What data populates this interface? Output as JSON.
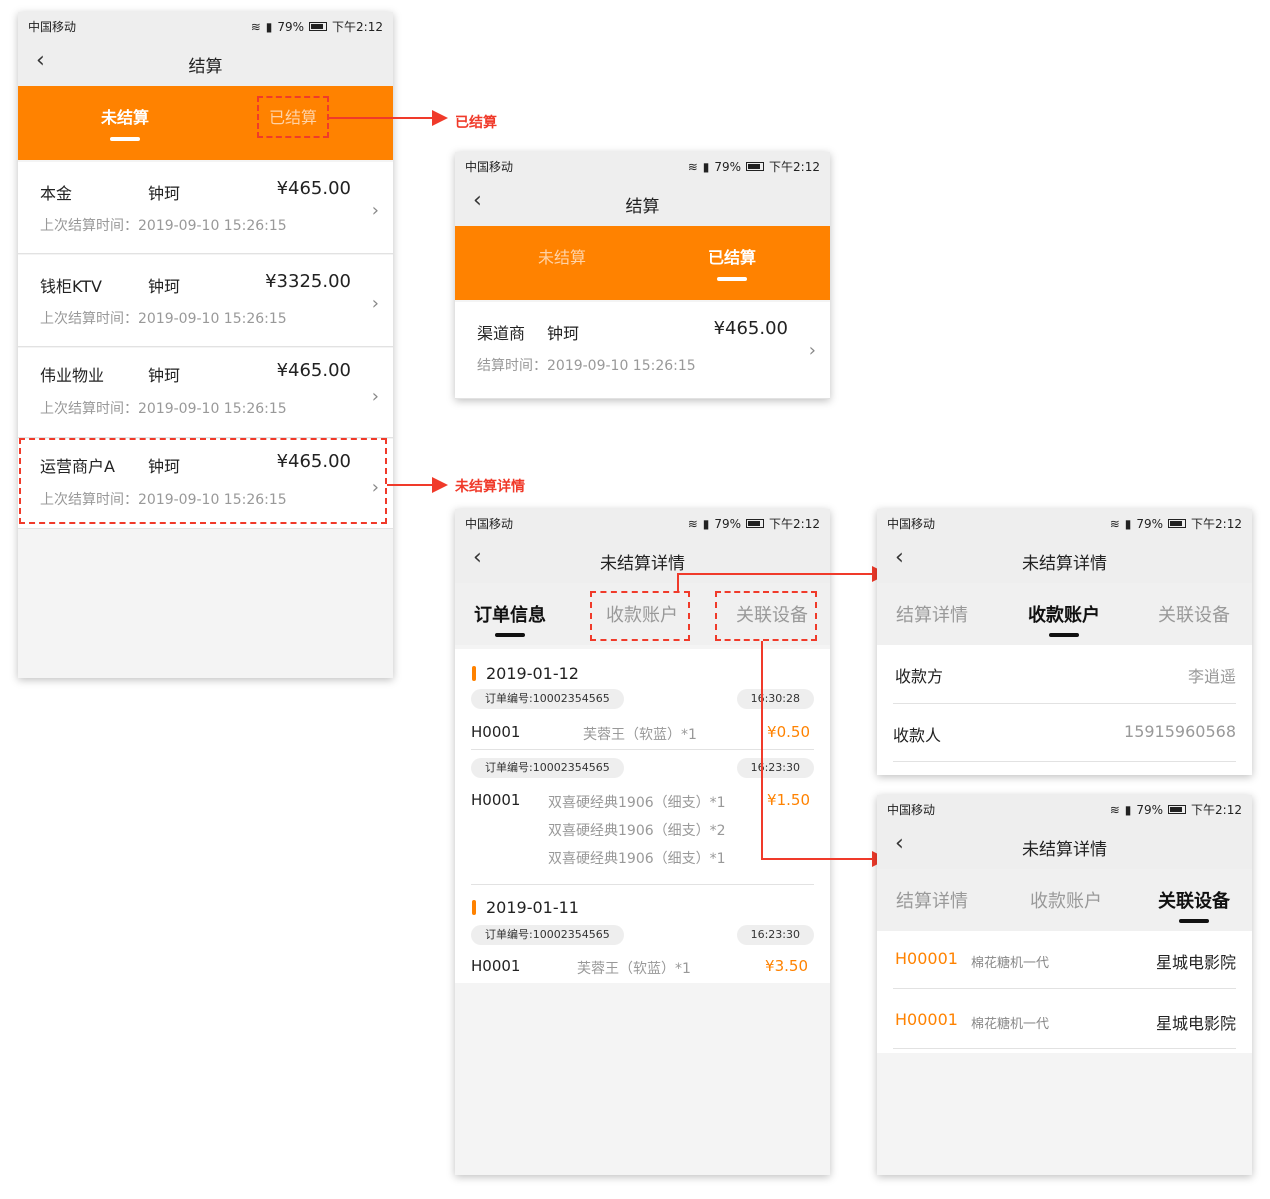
{
  "status": {
    "carrier": "中国移动",
    "battery": "79%",
    "time": "下午2:12"
  },
  "screen1": {
    "title": "结算",
    "tabs": [
      "未结算",
      "已结算"
    ],
    "rows": [
      {
        "name": "本金",
        "person": "钟珂",
        "amount": "¥465.00",
        "time": "上次结算时间：2019-09-10 15:26:15"
      },
      {
        "name": "钱柜KTV",
        "person": "钟珂",
        "amount": "¥3325.00",
        "time": "上次结算时间：2019-09-10 15:26:15"
      },
      {
        "name": "伟业物业",
        "person": "钟珂",
        "amount": "¥465.00",
        "time": "上次结算时间：2019-09-10 15:26:15"
      },
      {
        "name": "运营商户A",
        "person": "钟珂",
        "amount": "¥465.00",
        "time": "上次结算时间：2019-09-10 15:26:15"
      }
    ]
  },
  "annotations": {
    "settled": "已结算",
    "unsettled_detail": "未结算详情"
  },
  "screen2": {
    "title": "结算",
    "tabs": [
      "未结算",
      "已结算"
    ],
    "row": {
      "name": "渠道商",
      "person": "钟珂",
      "amount": "¥465.00",
      "time": "结算时间：2019-09-10 15:26:15"
    }
  },
  "screen3": {
    "title": "未结算详情",
    "tabs": [
      "订单信息",
      "收款账户",
      "关联设备"
    ],
    "groups": [
      {
        "date": "2019-01-12",
        "orders": [
          {
            "no": "订单编号:10002354565",
            "time": "16:30:28",
            "device": "H0001",
            "items": [
              "芙蓉王（软蓝）*1"
            ],
            "price": "¥0.50"
          },
          {
            "no": "订单编号:10002354565",
            "time": "16:23:30",
            "device": "H0001",
            "items": [
              "双喜硬经典1906（细支）*1",
              "双喜硬经典1906（细支）*2",
              "双喜硬经典1906（细支）*1"
            ],
            "price": "¥1.50"
          }
        ]
      },
      {
        "date": "2019-01-11",
        "orders": [
          {
            "no": "订单编号:10002354565",
            "time": "16:23:30",
            "device": "H0001",
            "items": [
              "芙蓉王（软蓝）*1"
            ],
            "price": "¥3.50"
          }
        ]
      }
    ]
  },
  "screen4": {
    "title": "未结算详情",
    "tabs": [
      "结算详情",
      "收款账户",
      "关联设备"
    ],
    "fields": [
      {
        "label": "收款方",
        "value": "李逍遥"
      },
      {
        "label": "收款人",
        "value": "15915960568"
      }
    ]
  },
  "screen5": {
    "title": "未结算详情",
    "tabs": [
      "结算详情",
      "收款账户",
      "关联设备"
    ],
    "devices": [
      {
        "code": "H00001",
        "name": "棉花糖机一代",
        "location": "星城电影院"
      },
      {
        "code": "H00001",
        "name": "棉花糖机一代",
        "location": "星城电影院"
      }
    ]
  }
}
